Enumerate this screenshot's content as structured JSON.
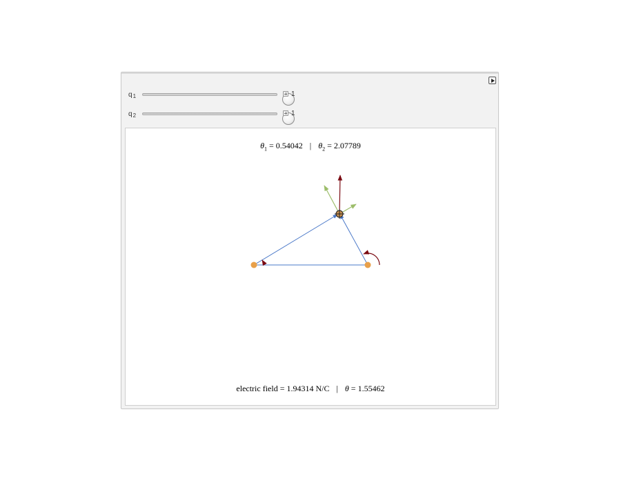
{
  "controls": {
    "q1": {
      "label": "q",
      "sub": "1",
      "value": "1"
    },
    "q2": {
      "label": "q",
      "sub": "2",
      "value": "1"
    }
  },
  "readout_top": {
    "theta1_symbol": "θ",
    "theta1_sub": "1",
    "theta1_value": "= 0.54042",
    "separator": "|",
    "theta2_symbol": "θ",
    "theta2_sub": "2",
    "theta2_value": "= 2.07789"
  },
  "readout_bottom": {
    "field_text": "electric field = 1.94314 N/C",
    "separator": "|",
    "theta_symbol": "θ",
    "theta_value": "= 1.55462"
  },
  "colors": {
    "charge": "#e8a04a",
    "line": "#4a78c8",
    "field_arrow": "#7a0a12",
    "component_arrow": "#9cbd6a"
  },
  "icons": {
    "toggle": "play-triangle-icon",
    "slider_increment": "plus-icon"
  }
}
